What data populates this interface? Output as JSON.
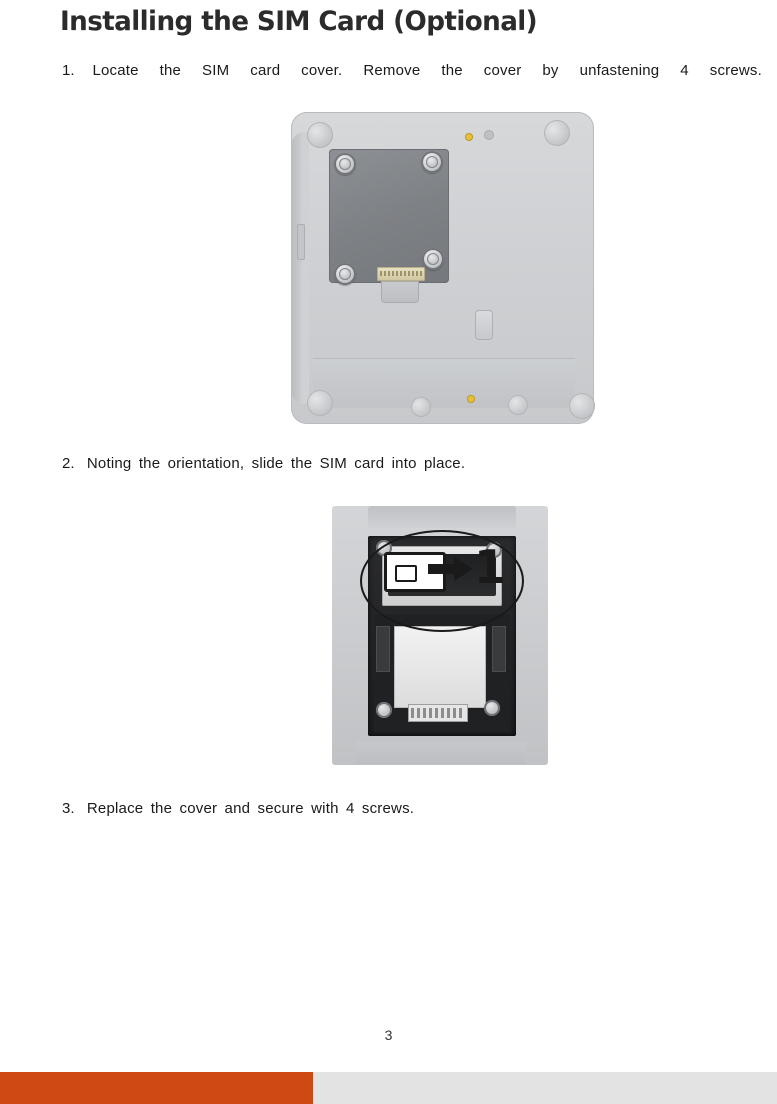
{
  "document": {
    "title": "Installing the SIM Card (Optional)",
    "page_number": "3",
    "steps": [
      {
        "number": "1.",
        "text": "Locate the SIM card cover. Remove the cover by unfastening 4 screws."
      },
      {
        "number": "2.",
        "text": "Noting the orientation, slide the SIM card into place."
      },
      {
        "number": "3.",
        "text": "Replace the cover and secure with 4 screws."
      }
    ],
    "figures": [
      {
        "name": "tablet-back-sim-cover",
        "caption": "",
        "callouts": []
      },
      {
        "name": "sim-slot-closeup",
        "caption": "",
        "callouts": [
          "1"
        ]
      }
    ],
    "footer": {
      "accent_color": "#ce4a12",
      "bar_color": "#e3e3e3"
    }
  }
}
